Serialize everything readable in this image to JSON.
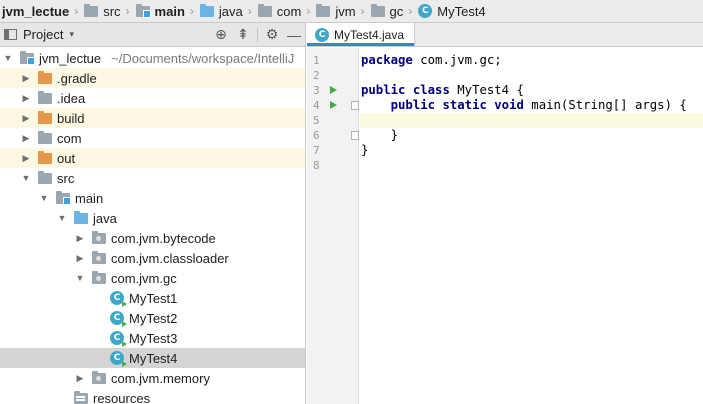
{
  "breadcrumb": {
    "items": [
      {
        "label": "jvm_lectue",
        "icon": "none",
        "bold": true
      },
      {
        "label": "src",
        "icon": "folder-icon"
      },
      {
        "label": "main",
        "icon": "source-folder-icon",
        "bold": true
      },
      {
        "label": "java",
        "icon": "java-folder-icon"
      },
      {
        "label": "com",
        "icon": "folder-icon"
      },
      {
        "label": "jvm",
        "icon": "folder-icon"
      },
      {
        "label": "gc",
        "icon": "folder-icon"
      },
      {
        "label": "MyTest4",
        "icon": "class-icon"
      }
    ],
    "separator": "›"
  },
  "project_panel": {
    "title": "Project",
    "caret": "▾",
    "tools": {
      "locate": "⊕",
      "collapse": "⇞",
      "settings": "⚙",
      "hide": "—"
    }
  },
  "tree": [
    {
      "label": "jvm_lectue",
      "path": "~/Documents/workspace/IntelliJ",
      "arrow": "▼",
      "indent": 0,
      "icon": "module",
      "state": "normal"
    },
    {
      "label": ".gradle",
      "arrow": "▶",
      "indent": 1,
      "icon": "orange",
      "state": "excluded"
    },
    {
      "label": ".idea",
      "arrow": "▶",
      "indent": 1,
      "icon": "grey",
      "state": "normal"
    },
    {
      "label": "build",
      "arrow": "▶",
      "indent": 1,
      "icon": "orange",
      "state": "excluded"
    },
    {
      "label": "com",
      "arrow": "▶",
      "indent": 1,
      "icon": "grey",
      "state": "normal"
    },
    {
      "label": "out",
      "arrow": "▶",
      "indent": 1,
      "icon": "orange",
      "state": "excluded"
    },
    {
      "label": "src",
      "arrow": "▼",
      "indent": 1,
      "icon": "grey",
      "state": "normal"
    },
    {
      "label": "main",
      "arrow": "▼",
      "indent": 2,
      "icon": "src",
      "state": "normal"
    },
    {
      "label": "java",
      "arrow": "▼",
      "indent": 3,
      "icon": "blue",
      "state": "normal"
    },
    {
      "label": "com.jvm.bytecode",
      "arrow": "▶",
      "indent": 4,
      "icon": "pkg",
      "state": "normal"
    },
    {
      "label": "com.jvm.classloader",
      "arrow": "▶",
      "indent": 4,
      "icon": "pkg",
      "state": "normal"
    },
    {
      "label": "com.jvm.gc",
      "arrow": "▼",
      "indent": 4,
      "icon": "pkg",
      "state": "normal"
    },
    {
      "label": "MyTest1",
      "arrow": "",
      "indent": 5,
      "icon": "class",
      "state": "normal"
    },
    {
      "label": "MyTest2",
      "arrow": "",
      "indent": 5,
      "icon": "class",
      "state": "normal"
    },
    {
      "label": "MyTest3",
      "arrow": "",
      "indent": 5,
      "icon": "class",
      "state": "normal"
    },
    {
      "label": "MyTest4",
      "arrow": "",
      "indent": 5,
      "icon": "class",
      "state": "selected"
    },
    {
      "label": "com.jvm.memory",
      "arrow": "▶",
      "indent": 4,
      "icon": "pkg",
      "state": "normal"
    },
    {
      "label": "resources",
      "arrow": "",
      "indent": 3,
      "icon": "res",
      "state": "normal"
    }
  ],
  "editor": {
    "tab_label": "MyTest4.java",
    "line_numbers": [
      "1",
      "2",
      "3",
      "4",
      "5",
      "6",
      "7",
      "8"
    ],
    "current_line": 5,
    "run_lines": [
      3,
      4
    ],
    "fold_lines": [
      4,
      6
    ],
    "lines": [
      [
        {
          "t": "package",
          "k": true
        },
        {
          "t": " com.jvm.gc;"
        }
      ],
      [],
      [
        {
          "t": "public",
          "k": true
        },
        {
          "t": " "
        },
        {
          "t": "class",
          "k": true
        },
        {
          "t": " MyTest4 {"
        }
      ],
      [
        {
          "t": "    "
        },
        {
          "t": "public",
          "k": true
        },
        {
          "t": " "
        },
        {
          "t": "static",
          "k": true
        },
        {
          "t": " "
        },
        {
          "t": "void",
          "k": true
        },
        {
          "t": " main(String[] args) {"
        }
      ],
      [],
      [
        {
          "t": "    }"
        }
      ],
      [
        {
          "t": "}"
        }
      ],
      []
    ]
  },
  "colors": {
    "accent": "#4083c9",
    "excluded_row": "#fcf8e1",
    "selected_row": "#d4d4d4",
    "keyword": "#000080",
    "run_marker": "#48a848"
  }
}
